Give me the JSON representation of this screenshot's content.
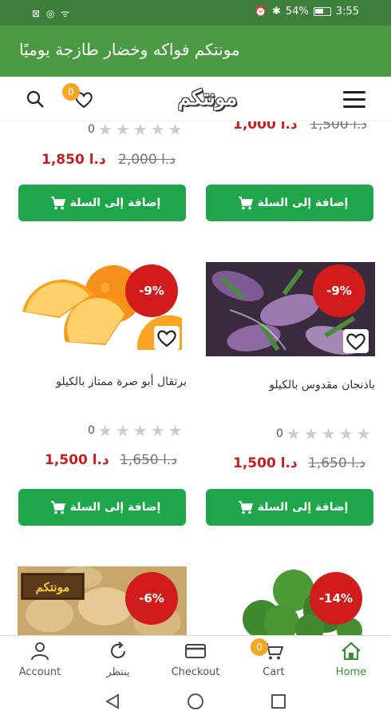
{
  "status": {
    "left_icons": "⊠ ◎ ᯤ",
    "battery": "54%",
    "time": "3:55"
  },
  "header": {
    "title": "مونتكم فواكه وخضار طازجة يوميًا",
    "logo": "مونتكم",
    "wishlist_count": "0"
  },
  "top_row": {
    "left": {
      "rating": "0",
      "price": "1,850 د.ا",
      "old_price": "2,000 د.ا"
    },
    "right": {
      "price": "1,000 د.ا",
      "old_price": "1,500 د.ا"
    }
  },
  "products": [
    {
      "name": "برتقال أبو صرة ممتاز بالكيلو",
      "discount": "-9%",
      "rating": "0",
      "price": "1,500 د.ا",
      "old_price": "1,650 د.ا",
      "image": "orange"
    },
    {
      "name": "باذنجان مقدوس بالكيلو",
      "discount": "-9%",
      "rating": "0",
      "price": "1,500 د.ا",
      "old_price": "1,650 د.ا",
      "image": "eggplant"
    },
    {
      "discount": "-6%",
      "image": "potato",
      "label": "مونتكم"
    },
    {
      "discount": "-14%",
      "image": "broccoli"
    }
  ],
  "add_to_cart_label": "إضافة إلى السلة",
  "bottom_nav": {
    "account": "Account",
    "wait": "ينتظر",
    "checkout": "Checkout",
    "cart": "Cart",
    "cart_count": "0",
    "home": "Home"
  },
  "colors": {
    "green_dark": "#3d7f3a",
    "green": "#4a9a44",
    "button": "#1fa64a",
    "discount": "#d21c1c",
    "badge": "#f5a623"
  }
}
